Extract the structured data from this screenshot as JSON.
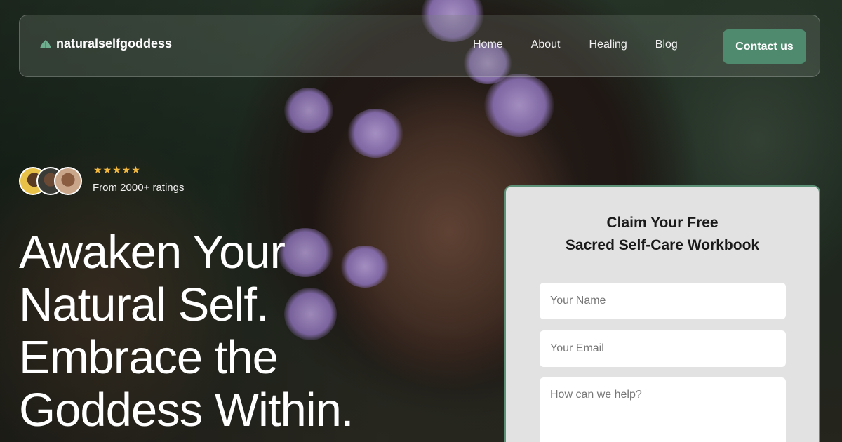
{
  "brand": {
    "name": "naturalselfgoddess",
    "icon": "leaf-icon",
    "accent_color": "#4f8a6e"
  },
  "nav": {
    "links": [
      {
        "label": "Home"
      },
      {
        "label": "About"
      },
      {
        "label": "Healing"
      },
      {
        "label": "Blog"
      }
    ],
    "contact_label": "Contact us"
  },
  "ratings": {
    "stars": "★★★★★",
    "star_count": 5,
    "star_color": "#f3b83e",
    "text": "From 2000+ ratings"
  },
  "hero": {
    "headline_lines": [
      "Awaken Your",
      "Natural Self.",
      "Embrace the",
      "Goddess Within."
    ]
  },
  "form": {
    "title_lines": [
      "Claim Your Free",
      "Sacred Self-Care Workbook"
    ],
    "name_placeholder": "Your Name",
    "email_placeholder": "Your Email",
    "message_placeholder": "How can we help?"
  }
}
